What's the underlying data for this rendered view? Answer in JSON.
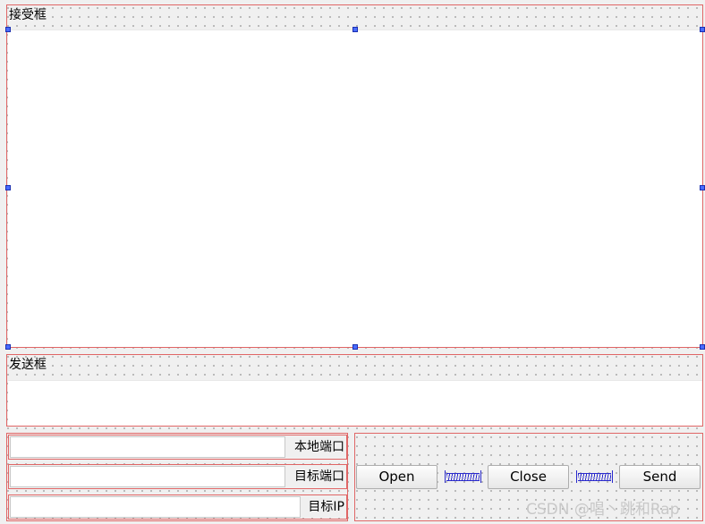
{
  "receive_group": {
    "title": "接受框"
  },
  "send_group": {
    "title": "发送框"
  },
  "port_fields": [
    {
      "label": "本地端口",
      "value": ""
    },
    {
      "label": "目标端口",
      "value": ""
    },
    {
      "label": "目标IP",
      "value": ""
    }
  ],
  "buttons": {
    "open": "Open",
    "close": "Close",
    "send": "Send"
  },
  "watermark": "CSDN @唱丶跳和Rap",
  "colors": {
    "layout_border": "#e06666",
    "selection_handle": "#4a6cff",
    "spacer": "#2a2acc"
  }
}
